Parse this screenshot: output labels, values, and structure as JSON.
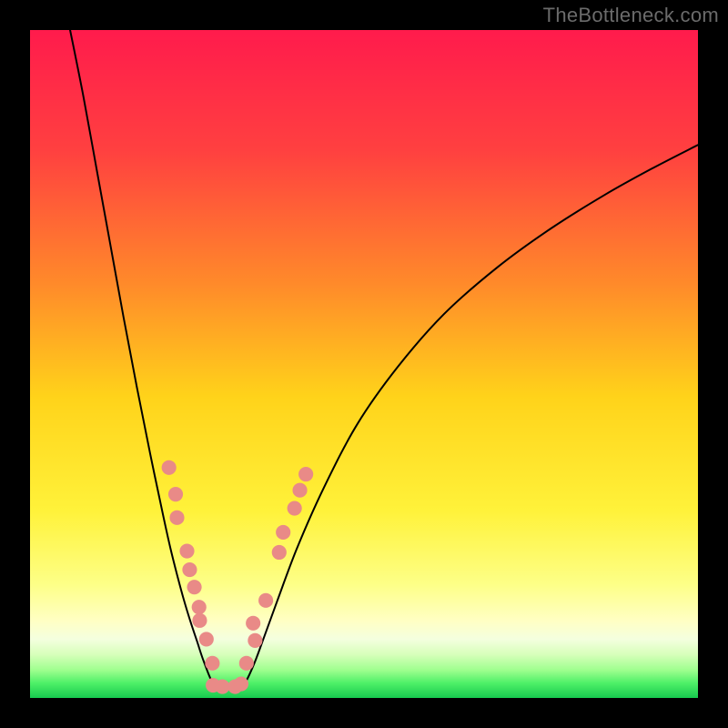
{
  "watermark": "TheBottleneck.com",
  "chart_data": {
    "type": "line",
    "title": "",
    "xlabel": "",
    "ylabel": "",
    "xlim": [
      0,
      100
    ],
    "ylim": [
      0,
      100
    ],
    "note": "Axes are percentage scales (0–100). Two smooth curves descend and meet near the bottom, resembling a bottleneck/V shape. Scatter dots cluster along the lower portions of both curves.",
    "background_gradient": {
      "type": "vertical-linear",
      "stops": [
        {
          "pos": 0.0,
          "color": "#ff1b4c"
        },
        {
          "pos": 0.18,
          "color": "#ff4040"
        },
        {
          "pos": 0.38,
          "color": "#ff8a2a"
        },
        {
          "pos": 0.55,
          "color": "#ffd31a"
        },
        {
          "pos": 0.72,
          "color": "#fff23a"
        },
        {
          "pos": 0.83,
          "color": "#fdff87"
        },
        {
          "pos": 0.885,
          "color": "#ffffc4"
        },
        {
          "pos": 0.912,
          "color": "#f4ffdf"
        },
        {
          "pos": 0.935,
          "color": "#d7ffba"
        },
        {
          "pos": 0.958,
          "color": "#9fff8f"
        },
        {
          "pos": 0.978,
          "color": "#4df067"
        },
        {
          "pos": 1.0,
          "color": "#17c94f"
        }
      ]
    },
    "series": [
      {
        "name": "left-curve",
        "x": [
          6.0,
          8.0,
          10.0,
          12.0,
          14.0,
          16.0,
          18.0,
          20.0,
          21.0,
          22.0,
          23.0,
          24.0,
          25.0,
          26.0,
          27.5
        ],
        "y": [
          100,
          90.0,
          79.0,
          68.0,
          57.0,
          46.5,
          36.5,
          27.0,
          22.5,
          18.5,
          14.8,
          11.5,
          8.5,
          5.5,
          2.0
        ]
      },
      {
        "name": "bottom-segment",
        "x": [
          27.5,
          29.0,
          30.5,
          32.0
        ],
        "y": [
          2.0,
          1.6,
          1.6,
          2.0
        ]
      },
      {
        "name": "right-curve",
        "x": [
          32.0,
          33.5,
          35.0,
          37.0,
          40.0,
          44.0,
          49.0,
          55.0,
          62.0,
          70.0,
          78.0,
          86.0,
          93.0,
          100.0
        ],
        "y": [
          2.0,
          5.0,
          9.0,
          14.5,
          22.5,
          31.5,
          41.0,
          49.5,
          57.5,
          64.5,
          70.3,
          75.3,
          79.2,
          82.8
        ]
      }
    ],
    "scatter": {
      "name": "dots",
      "color": "#e98a87",
      "radius_pct": 1.1,
      "points": [
        {
          "x": 20.8,
          "y": 34.5
        },
        {
          "x": 21.8,
          "y": 30.5
        },
        {
          "x": 22.0,
          "y": 27.0
        },
        {
          "x": 23.5,
          "y": 22.0
        },
        {
          "x": 23.9,
          "y": 19.2
        },
        {
          "x": 24.6,
          "y": 16.6
        },
        {
          "x": 25.3,
          "y": 13.6
        },
        {
          "x": 25.4,
          "y": 11.6
        },
        {
          "x": 26.4,
          "y": 8.8
        },
        {
          "x": 27.3,
          "y": 5.2
        },
        {
          "x": 27.4,
          "y": 1.9
        },
        {
          "x": 28.8,
          "y": 1.7
        },
        {
          "x": 30.7,
          "y": 1.7
        },
        {
          "x": 31.6,
          "y": 2.1
        },
        {
          "x": 32.4,
          "y": 5.2
        },
        {
          "x": 33.7,
          "y": 8.6
        },
        {
          "x": 33.4,
          "y": 11.2
        },
        {
          "x": 35.3,
          "y": 14.6
        },
        {
          "x": 37.3,
          "y": 21.8
        },
        {
          "x": 37.9,
          "y": 24.8
        },
        {
          "x": 39.6,
          "y": 28.4
        },
        {
          "x": 40.4,
          "y": 31.1
        },
        {
          "x": 41.3,
          "y": 33.5
        }
      ]
    }
  }
}
